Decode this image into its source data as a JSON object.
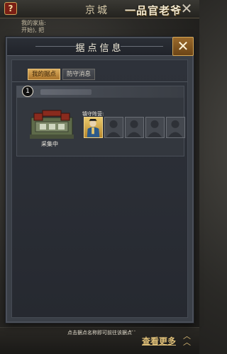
{
  "background": {
    "title": "京城",
    "logo_text": "一品官老爷",
    "lines": [
      "我的家庙:",
      "开始), 把"
    ],
    "see_more_label": "查看更多",
    "ellipsis": "..."
  },
  "modal": {
    "title": "据点信息",
    "tabs": [
      {
        "label": "我的据点",
        "active": true
      },
      {
        "label": "防守消息",
        "active": false
      }
    ],
    "stronghold": {
      "index": "1",
      "status": "采集中",
      "garrison_label": "镇守阵营:",
      "slots": [
        "hero",
        "empty",
        "empty",
        "empty",
        "empty"
      ]
    },
    "footer_hint": "点击据点名称即可前往该据点"
  },
  "colors": {
    "accent_gold": "#d9ab5c",
    "modal_bg": "#3a3f47",
    "close_bg": "#8a5a22"
  },
  "icons": {
    "help": "question-icon",
    "close": "close-icon",
    "expand": "double-chevron-up-icon"
  }
}
